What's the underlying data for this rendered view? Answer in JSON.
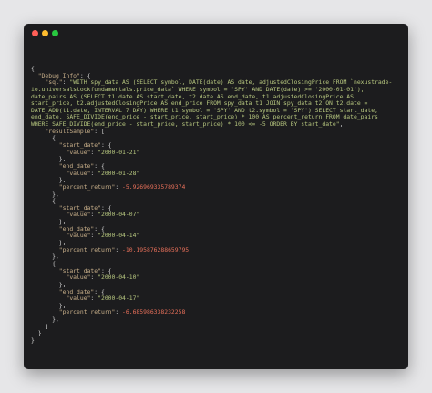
{
  "window": {
    "buttons": [
      "close",
      "minimize",
      "zoom"
    ]
  },
  "code_lines": [
    {
      "indent": 0,
      "parts": [
        {
          "t": "{",
          "c": "p"
        }
      ]
    },
    {
      "indent": 2,
      "parts": [
        {
          "t": "\"Debug Info\"",
          "c": "key"
        },
        {
          "t": ": {",
          "c": "p"
        }
      ]
    },
    {
      "indent": 4,
      "parts": [
        {
          "t": "\"sql\"",
          "c": "key"
        },
        {
          "t": ": ",
          "c": "p"
        },
        {
          "t": "\"WITH spy_data AS (SELECT symbol, DATE(date) AS date, adjustedClosingPrice FROM `nexustrade-",
          "c": "str"
        }
      ]
    },
    {
      "indent": 0,
      "parts": [
        {
          "t": "io.universalstockfundamentals.price_data` WHERE symbol = 'SPY' AND DATE(date) >= '2000-01-01'),",
          "c": "str"
        }
      ]
    },
    {
      "indent": 0,
      "parts": [
        {
          "t": "date_pairs AS (SELECT t1.date AS start_date, t2.date AS end_date, t1.adjustedClosingPrice AS",
          "c": "str"
        }
      ]
    },
    {
      "indent": 0,
      "parts": [
        {
          "t": "start_price, t2.adjustedClosingPrice AS end_price FROM spy_data t1 JOIN spy_data t2 ON t2.date =",
          "c": "str"
        }
      ]
    },
    {
      "indent": 0,
      "parts": [
        {
          "t": "DATE_ADD(t1.date, INTERVAL 7 DAY) WHERE t1.symbol = 'SPY' AND t2.symbol = 'SPY') SELECT start_date,",
          "c": "str"
        }
      ]
    },
    {
      "indent": 0,
      "parts": [
        {
          "t": "end_date, SAFE_DIVIDE(end_price - start_price, start_price) * 100 AS percent_return FROM date_pairs",
          "c": "str"
        }
      ]
    },
    {
      "indent": 0,
      "parts": [
        {
          "t": "WHERE SAFE_DIVIDE(end_price - start_price, start_price) * 100 <= -5 ORDER BY start_date\"",
          "c": "str"
        },
        {
          "t": ",",
          "c": "p"
        }
      ]
    },
    {
      "indent": 4,
      "parts": [
        {
          "t": "\"resultSample\"",
          "c": "key"
        },
        {
          "t": ": [",
          "c": "p"
        }
      ]
    },
    {
      "indent": 6,
      "parts": [
        {
          "t": "{",
          "c": "p"
        }
      ]
    },
    {
      "indent": 8,
      "parts": [
        {
          "t": "\"start_date\"",
          "c": "key"
        },
        {
          "t": ": {",
          "c": "p"
        }
      ]
    },
    {
      "indent": 10,
      "parts": [
        {
          "t": "\"value\"",
          "c": "key"
        },
        {
          "t": ": ",
          "c": "p"
        },
        {
          "t": "\"2000-01-21\"",
          "c": "str"
        }
      ]
    },
    {
      "indent": 8,
      "parts": [
        {
          "t": "},",
          "c": "p"
        }
      ]
    },
    {
      "indent": 8,
      "parts": [
        {
          "t": "\"end_date\"",
          "c": "key"
        },
        {
          "t": ": {",
          "c": "p"
        }
      ]
    },
    {
      "indent": 10,
      "parts": [
        {
          "t": "\"value\"",
          "c": "key"
        },
        {
          "t": ": ",
          "c": "p"
        },
        {
          "t": "\"2000-01-28\"",
          "c": "str"
        }
      ]
    },
    {
      "indent": 8,
      "parts": [
        {
          "t": "},",
          "c": "p"
        }
      ]
    },
    {
      "indent": 8,
      "parts": [
        {
          "t": "\"percent_return\"",
          "c": "key"
        },
        {
          "t": ": ",
          "c": "p"
        },
        {
          "t": "-5.926969335789374",
          "c": "num"
        }
      ]
    },
    {
      "indent": 6,
      "parts": [
        {
          "t": "},",
          "c": "p"
        }
      ]
    },
    {
      "indent": 6,
      "parts": [
        {
          "t": "{",
          "c": "p"
        }
      ]
    },
    {
      "indent": 8,
      "parts": [
        {
          "t": "\"start_date\"",
          "c": "key"
        },
        {
          "t": ": {",
          "c": "p"
        }
      ]
    },
    {
      "indent": 10,
      "parts": [
        {
          "t": "\"value\"",
          "c": "key"
        },
        {
          "t": ": ",
          "c": "p"
        },
        {
          "t": "\"2000-04-07\"",
          "c": "str"
        }
      ]
    },
    {
      "indent": 8,
      "parts": [
        {
          "t": "},",
          "c": "p"
        }
      ]
    },
    {
      "indent": 8,
      "parts": [
        {
          "t": "\"end_date\"",
          "c": "key"
        },
        {
          "t": ": {",
          "c": "p"
        }
      ]
    },
    {
      "indent": 10,
      "parts": [
        {
          "t": "\"value\"",
          "c": "key"
        },
        {
          "t": ": ",
          "c": "p"
        },
        {
          "t": "\"2000-04-14\"",
          "c": "str"
        }
      ]
    },
    {
      "indent": 8,
      "parts": [
        {
          "t": "},",
          "c": "p"
        }
      ]
    },
    {
      "indent": 8,
      "parts": [
        {
          "t": "\"percent_return\"",
          "c": "key"
        },
        {
          "t": ": ",
          "c": "p"
        },
        {
          "t": "-10.195876288659795",
          "c": "num"
        }
      ]
    },
    {
      "indent": 6,
      "parts": [
        {
          "t": "},",
          "c": "p"
        }
      ]
    },
    {
      "indent": 6,
      "parts": [
        {
          "t": "{",
          "c": "p"
        }
      ]
    },
    {
      "indent": 8,
      "parts": [
        {
          "t": "\"start_date\"",
          "c": "key"
        },
        {
          "t": ": {",
          "c": "p"
        }
      ]
    },
    {
      "indent": 10,
      "parts": [
        {
          "t": "\"value\"",
          "c": "key"
        },
        {
          "t": ": ",
          "c": "p"
        },
        {
          "t": "\"2000-04-10\"",
          "c": "str"
        }
      ]
    },
    {
      "indent": 8,
      "parts": [
        {
          "t": "},",
          "c": "p"
        }
      ]
    },
    {
      "indent": 8,
      "parts": [
        {
          "t": "\"end_date\"",
          "c": "key"
        },
        {
          "t": ": {",
          "c": "p"
        }
      ]
    },
    {
      "indent": 10,
      "parts": [
        {
          "t": "\"value\"",
          "c": "key"
        },
        {
          "t": ": ",
          "c": "p"
        },
        {
          "t": "\"2000-04-17\"",
          "c": "str"
        }
      ]
    },
    {
      "indent": 8,
      "parts": [
        {
          "t": "},",
          "c": "p"
        }
      ]
    },
    {
      "indent": 8,
      "parts": [
        {
          "t": "\"percent_return\"",
          "c": "key"
        },
        {
          "t": ": ",
          "c": "p"
        },
        {
          "t": "-6.685986338232258",
          "c": "num"
        }
      ]
    },
    {
      "indent": 6,
      "parts": [
        {
          "t": "},",
          "c": "p"
        }
      ]
    },
    {
      "indent": 4,
      "parts": [
        {
          "t": "]",
          "c": "p"
        }
      ]
    },
    {
      "indent": 2,
      "parts": [
        {
          "t": "}",
          "c": "p"
        }
      ]
    },
    {
      "indent": 0,
      "parts": [
        {
          "t": "}",
          "c": "p"
        }
      ]
    }
  ],
  "colors": {
    "background": "#e6e6e8",
    "window": "#1c1c1e",
    "text": "#d6d6d6",
    "string": "#b7c77f",
    "number": "#e8705a",
    "key": "#c9b08a",
    "close": "#ff5f57",
    "minimize": "#febc2e",
    "zoom": "#28c840"
  }
}
